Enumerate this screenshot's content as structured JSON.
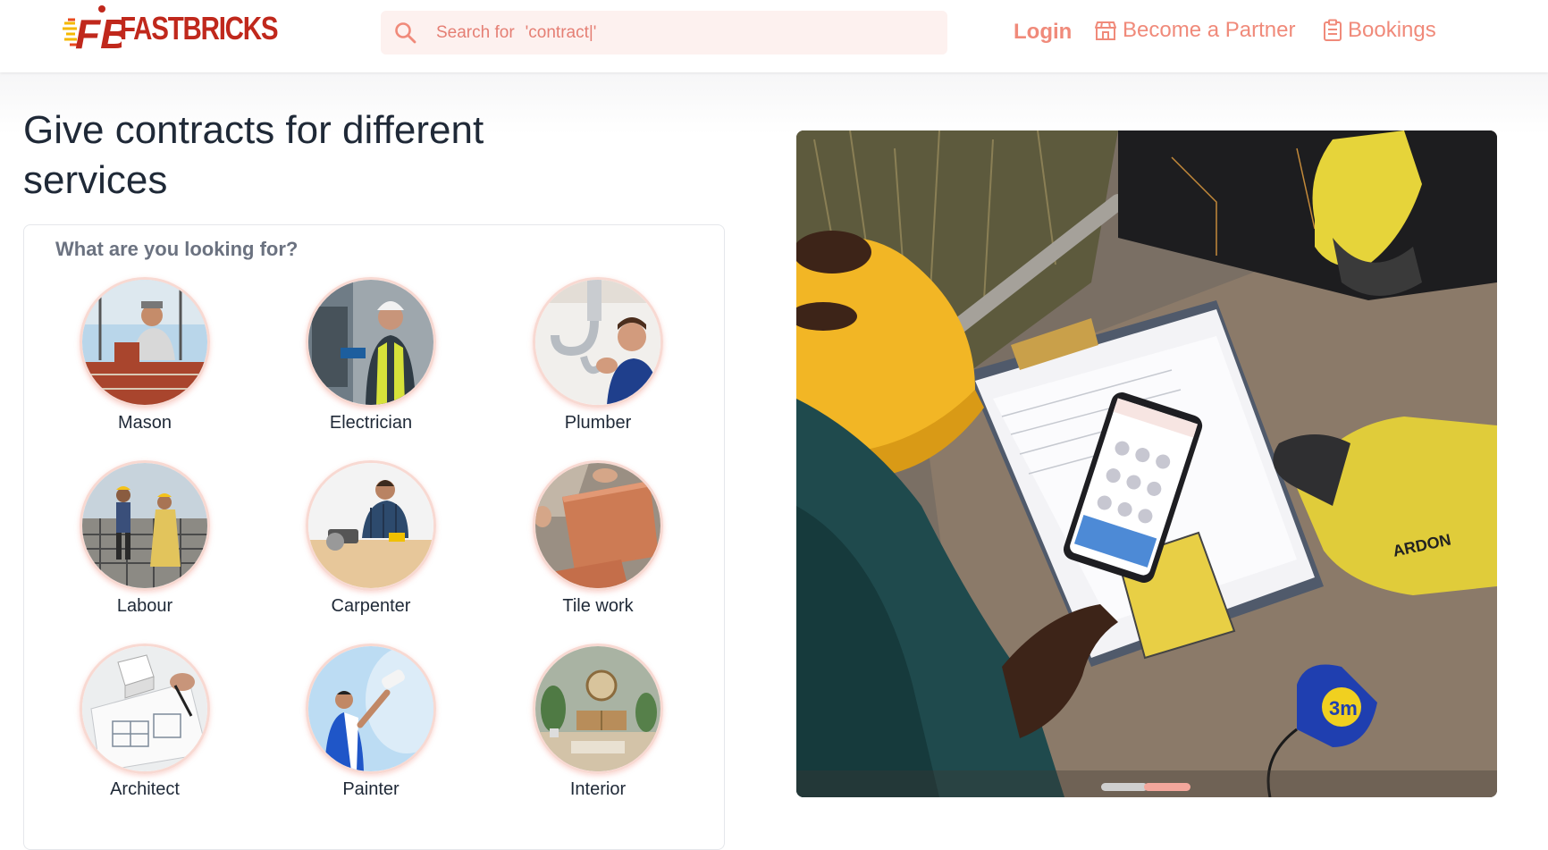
{
  "brand": {
    "name": "FASTBRICKS",
    "logo_letters": "FB",
    "color": "#c0281c"
  },
  "search": {
    "label": "Search for",
    "value": "'contract|'"
  },
  "nav": {
    "login": "Login",
    "partner": "Become a Partner",
    "bookings": "Bookings",
    "accent": "#f08a7a"
  },
  "headline": "Give contracts for different services",
  "panel": {
    "title": "What are you looking for?",
    "services": [
      {
        "label": "Mason",
        "icon": "mason-photo"
      },
      {
        "label": "Electrician",
        "icon": "electrician-photo"
      },
      {
        "label": "Plumber",
        "icon": "plumber-photo"
      },
      {
        "label": "Labour",
        "icon": "labour-photo"
      },
      {
        "label": "Carpenter",
        "icon": "carpenter-photo"
      },
      {
        "label": "Tile work",
        "icon": "tile-work-photo"
      },
      {
        "label": "Architect",
        "icon": "architect-photo"
      },
      {
        "label": "Painter",
        "icon": "painter-photo"
      },
      {
        "label": "Interior",
        "icon": "interior-photo"
      }
    ]
  },
  "hero": {
    "slide_count": 2,
    "active_slide": 2,
    "tape_text": "3m",
    "glove_text": "ARDON"
  }
}
